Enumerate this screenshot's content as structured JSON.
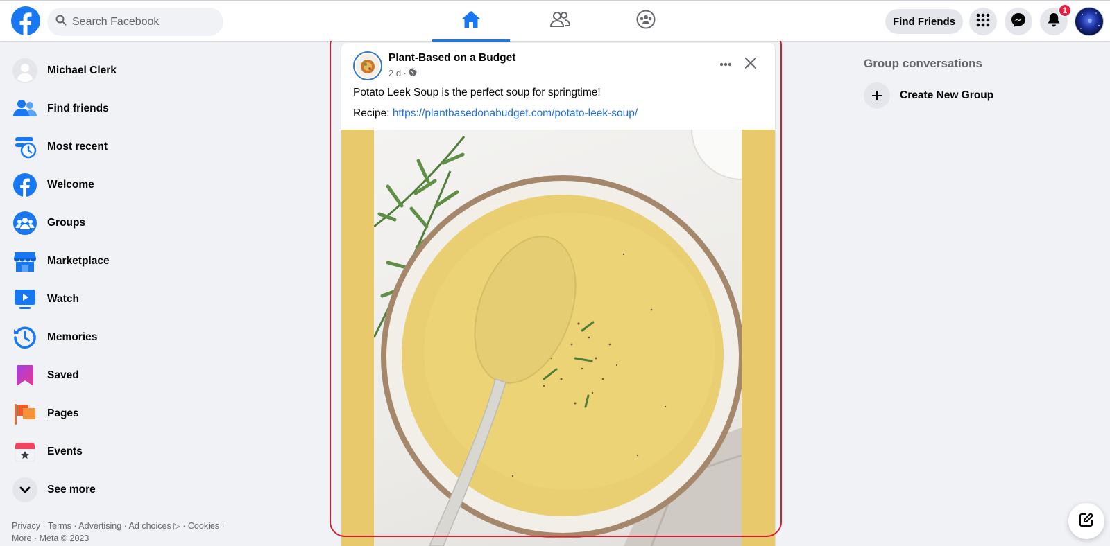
{
  "topbar": {
    "search_placeholder": "Search Facebook",
    "find_friends_label": "Find Friends",
    "notifications_count": "1"
  },
  "sidebar": {
    "items": [
      {
        "label": "Michael Clerk",
        "icon": "user-avatar-icon"
      },
      {
        "label": "Find friends",
        "icon": "friends-icon"
      },
      {
        "label": "Most recent",
        "icon": "most-recent-icon"
      },
      {
        "label": "Welcome",
        "icon": "facebook-icon"
      },
      {
        "label": "Groups",
        "icon": "groups-icon"
      },
      {
        "label": "Marketplace",
        "icon": "marketplace-icon"
      },
      {
        "label": "Watch",
        "icon": "watch-icon"
      },
      {
        "label": "Memories",
        "icon": "memories-icon"
      },
      {
        "label": "Saved",
        "icon": "saved-icon"
      },
      {
        "label": "Pages",
        "icon": "pages-icon"
      },
      {
        "label": "Events",
        "icon": "events-icon"
      },
      {
        "label": "See more",
        "icon": "chevron-down-icon"
      }
    ],
    "footer_line1": "Privacy · Terms · Advertising · Ad choices ▷ · Cookies ·",
    "footer_line2": "More · Meta © 2023"
  },
  "right": {
    "title": "Group conversations",
    "create_group_label": "Create New Group"
  },
  "post": {
    "author": "Plant-Based on a Budget",
    "time": "2 d ·",
    "text": "Potato Leek Soup is the perfect soup for springtime!",
    "recipe_label": "Recipe: ",
    "recipe_link": "https://plantbasedonabudget.com/potato-leek-soup/"
  },
  "colors": {
    "brand": "#1877f2",
    "highlight": "#d41f2e",
    "link": "#216fdb",
    "image_border": "#e8c96b"
  }
}
